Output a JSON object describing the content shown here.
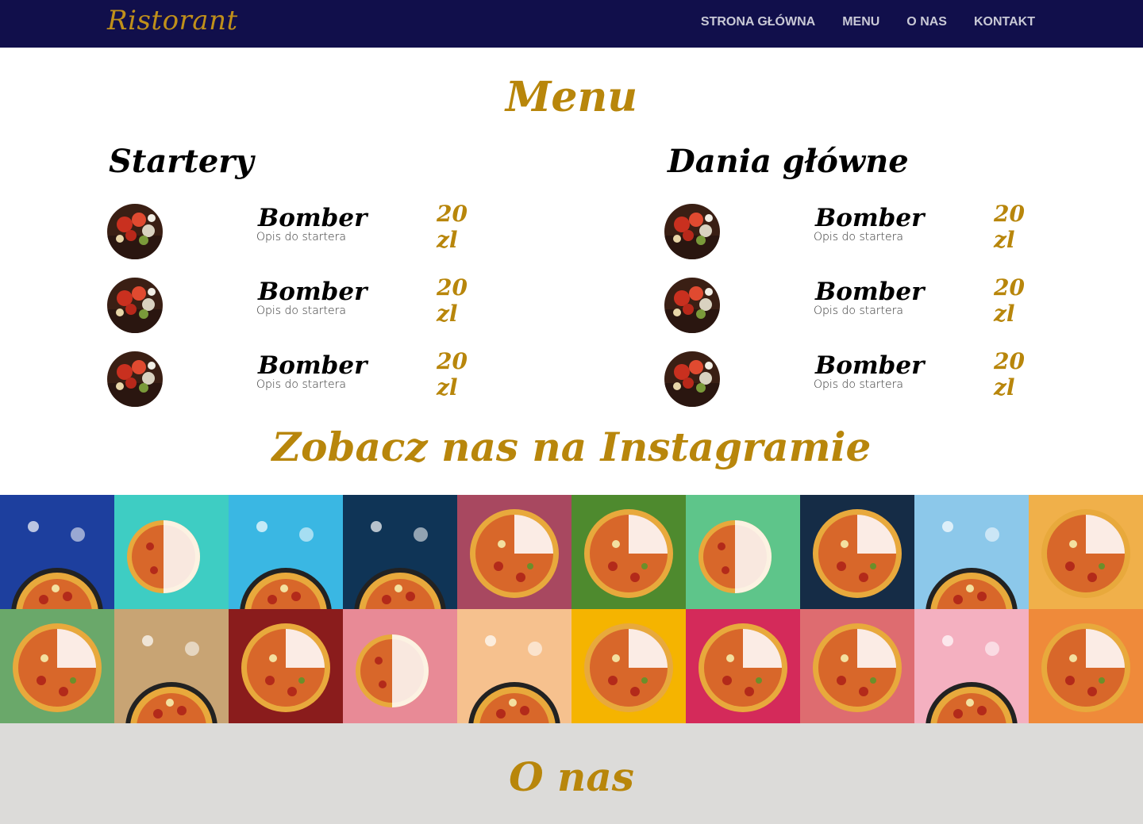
{
  "nav": {
    "logo": "Ristorant",
    "links": [
      "STRONA GŁÓWNA",
      "MENU",
      "O NAS",
      "KONTAKT"
    ]
  },
  "menu": {
    "title": "Menu",
    "starters": {
      "heading": "Startery",
      "items": [
        {
          "name": "Bomber",
          "desc": "Opis do startera",
          "price": "20 zl"
        },
        {
          "name": "Bomber",
          "desc": "Opis do startera",
          "price": "20 zl"
        },
        {
          "name": "Bomber",
          "desc": "Opis do startera",
          "price": "20 zl"
        }
      ]
    },
    "mains": {
      "heading": "Dania główne",
      "items": [
        {
          "name": "Bomber",
          "desc": "Opis do startera",
          "price": "20 zl"
        },
        {
          "name": "Bomber",
          "desc": "Opis do startera",
          "price": "20 zl"
        },
        {
          "name": "Bomber",
          "desc": "Opis do startera",
          "price": "20 zl"
        }
      ]
    }
  },
  "instagram": {
    "title": "Zobacz nas na Instagramie",
    "tiles": [
      {
        "bg": "#1d3f9e",
        "type": "pizza-bottom"
      },
      {
        "bg": "#3ecdc3",
        "type": "pizza-slices"
      },
      {
        "bg": "#3ab7e3",
        "type": "pizza-bottom"
      },
      {
        "bg": "#0f3456",
        "type": "pizza-bottom"
      },
      {
        "bg": "#a84860",
        "type": "pizza-center"
      },
      {
        "bg": "#4e8a2e",
        "type": "pizza-center"
      },
      {
        "bg": "#5ec58a",
        "type": "pizza-slices"
      },
      {
        "bg": "#152c46",
        "type": "pizza-center"
      },
      {
        "bg": "#8cc8ea",
        "type": "pizza-bottom"
      },
      {
        "bg": "#f0b04a",
        "type": "pizza-center"
      },
      {
        "bg": "#6aa86a",
        "type": "pizza-center"
      },
      {
        "bg": "#c8a474",
        "type": "pizza-bottom"
      },
      {
        "bg": "#8a1c1c",
        "type": "pizza-center"
      },
      {
        "bg": "#e88a96",
        "type": "pizza-slices"
      },
      {
        "bg": "#f6c18e",
        "type": "pizza-bottom"
      },
      {
        "bg": "#f5b400",
        "type": "pizza-center"
      },
      {
        "bg": "#d42a5a",
        "type": "pizza-center"
      },
      {
        "bg": "#de6c70",
        "type": "pizza-center"
      },
      {
        "bg": "#f4b0c0",
        "type": "pizza-bottom"
      },
      {
        "bg": "#ef8a3a",
        "type": "pizza-center"
      }
    ]
  },
  "about": {
    "title": "O nas"
  }
}
